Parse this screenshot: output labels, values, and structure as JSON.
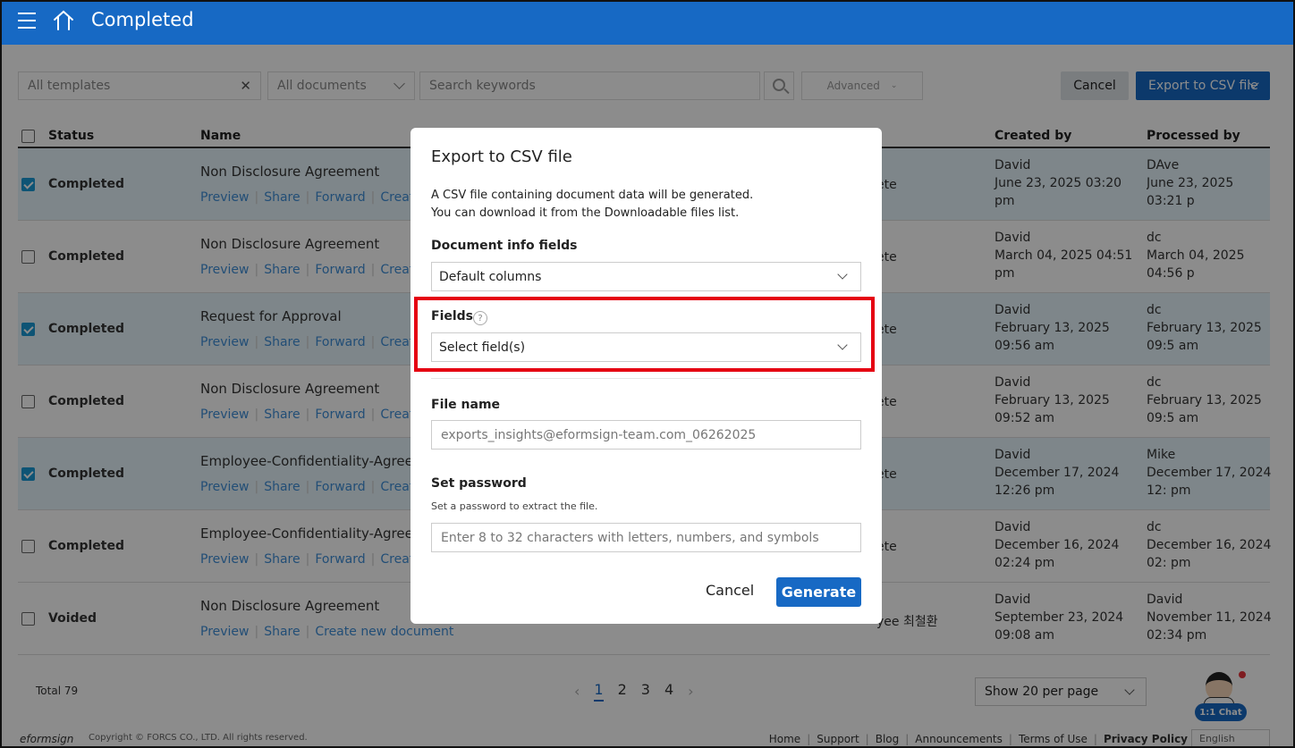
{
  "header": {
    "title": "Completed"
  },
  "toolbar": {
    "templates_placeholder": "All templates",
    "documents_filter": "All documents",
    "search_placeholder": "Search keywords",
    "advanced_label": "Advanced",
    "cancel_label": "Cancel",
    "export_label": "Export to CSV file"
  },
  "table": {
    "headers": {
      "status": "Status",
      "name": "Name",
      "created_by": "Created by",
      "processed_by": "Processed by"
    },
    "action_labels": {
      "preview": "Preview",
      "share": "Share",
      "forward": "Forward",
      "create": "Create",
      "create_new": "Create new document"
    },
    "rows": [
      {
        "checked": true,
        "status": "Completed",
        "name": "Non Disclosure Agreement",
        "step": "ete",
        "created_by": "David",
        "created_at": "June 23, 2025 03:20 pm",
        "processed_by": "DAve",
        "processed_at": "June 23, 2025 03:21 p"
      },
      {
        "checked": false,
        "status": "Completed",
        "name": "Non Disclosure Agreement",
        "step": "ete",
        "created_by": "David",
        "created_at": "March 04, 2025 04:51 pm",
        "processed_by": "dc",
        "processed_at": "March 04, 2025 04:56 p"
      },
      {
        "checked": true,
        "status": "Completed",
        "name": "Request for Approval",
        "step": "ete",
        "created_by": "David",
        "created_at": "February 13, 2025 09:56 am",
        "processed_by": "dc",
        "processed_at": "February 13, 2025 09:5 am"
      },
      {
        "checked": false,
        "status": "Completed",
        "name": "Non Disclosure Agreement",
        "step": "ete",
        "created_by": "David",
        "created_at": "February 13, 2025 09:52 am",
        "processed_by": "dc",
        "processed_at": "February 13, 2025 09:5 am"
      },
      {
        "checked": true,
        "status": "Completed",
        "name": "Employee-Confidentiality-Agreem",
        "step": "ete",
        "created_by": "David",
        "created_at": "December 17, 2024 12:26 pm",
        "processed_by": "Mike",
        "processed_at": "December 17, 2024 12: pm"
      },
      {
        "checked": false,
        "status": "Completed",
        "name": "Employee-Confidentiality-Agreem",
        "step": "ete",
        "created_by": "David",
        "created_at": "December 16, 2024 02:24 pm",
        "processed_by": "dc",
        "processed_at": "December 16, 2024 02: pm"
      },
      {
        "checked": false,
        "status": "Voided",
        "name": "Non Disclosure Agreement",
        "step": "yee 최철환",
        "created_by": "David",
        "created_at": "September 23, 2024 09:08 am",
        "processed_by": "David",
        "processed_at": "November 11, 2024 02:34 pm"
      }
    ]
  },
  "footer": {
    "total": "Total 79",
    "pages": [
      "1",
      "2",
      "3",
      "4"
    ],
    "current_page": "1",
    "per_page": "Show 20 per page",
    "chat_label": "1:1 Chat",
    "brand": "eformsign",
    "copyright": "Copyright © FORCS CO., LTD. All rights reserved.",
    "links": [
      "Home",
      "Support",
      "Blog",
      "Announcements",
      "Terms of Use",
      "Privacy Policy"
    ],
    "language": "English"
  },
  "modal": {
    "title": "Export to CSV file",
    "description_line1": "A CSV file containing document data will be generated.",
    "description_line2": "You can download it from the Downloadable files list.",
    "doc_info_label": "Document info fields",
    "doc_info_value": "Default columns",
    "fields_label": "Fields",
    "fields_placeholder": "Select field(s)",
    "file_name_label": "File name",
    "file_name_value": "exports_insights@eformsign-team.com_06262025",
    "password_label": "Set password",
    "password_hint": "Set a password to extract the file.",
    "password_placeholder": "Enter 8 to 32 characters with letters, numbers, and symbols",
    "cancel_label": "Cancel",
    "generate_label": "Generate"
  },
  "colors": {
    "brand_blue": "#1769c4",
    "highlight_red": "#e50012",
    "link_blue": "#3f8ed8"
  }
}
